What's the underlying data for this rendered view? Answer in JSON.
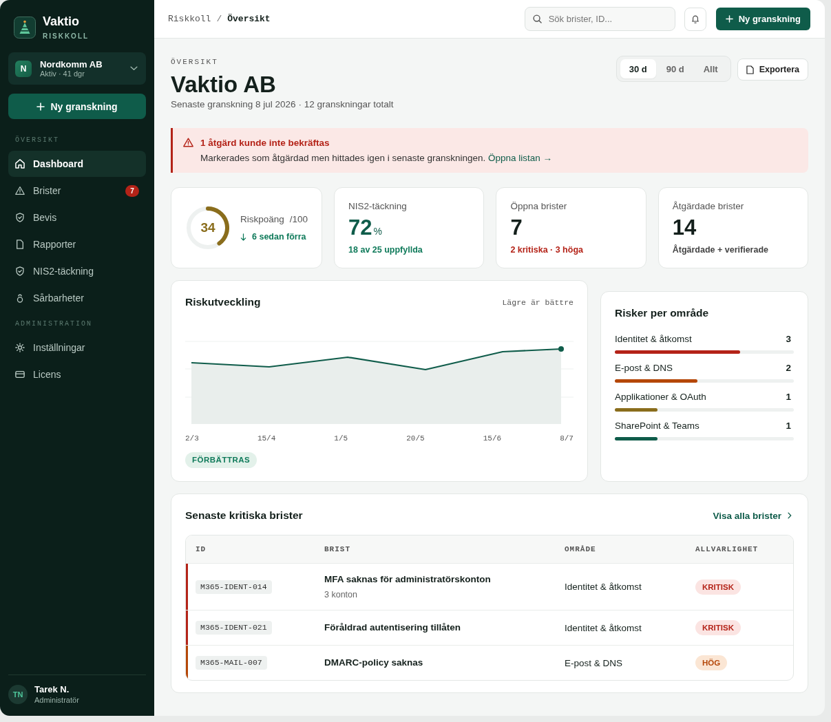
{
  "sidebar": {
    "brand": {
      "name": "Vaktio",
      "tagline": "RISKKOLL"
    },
    "org": {
      "avatar": "N",
      "name": "Nordkomm AB",
      "status": "Aktiv · 41 dgr"
    },
    "new_button": "Ny granskning",
    "sections": [
      {
        "title": "ÖVERSIKT",
        "items": [
          {
            "label": "Dashboard",
            "selected": true
          },
          {
            "label": "Brister",
            "selected": false,
            "badge": "7"
          },
          {
            "label": "Bevis",
            "selected": false
          },
          {
            "label": "Rapporter",
            "selected": false
          },
          {
            "label": "NIS2-täckning",
            "selected": false
          },
          {
            "label": "Sårbarheter",
            "selected": false
          }
        ]
      },
      {
        "title": "ADMINISTRATION",
        "items": [
          {
            "label": "Inställningar",
            "selected": false
          },
          {
            "label": "Licens",
            "selected": false
          }
        ]
      }
    ],
    "user": {
      "avatar": "TN",
      "name": "Tarek N.",
      "role": "Administratör"
    }
  },
  "header": {
    "breadcrumb": [
      {
        "label": "Riskkoll",
        "current": false
      },
      {
        "label": "Översikt",
        "current": true
      }
    ],
    "separator": "/",
    "search": {
      "placeholder": "Sök brister, ID..."
    },
    "new_button": "Ny granskning"
  },
  "page": {
    "eyebrow": "ÖVERSIKT",
    "title": "Vaktio AB",
    "subtitle": "Senaste granskning 8 jul 2026 · 12 granskningar totalt",
    "ranges": [
      {
        "label": "30 d",
        "selected": true
      },
      {
        "label": "90 d",
        "selected": false
      },
      {
        "label": "Allt",
        "selected": false
      }
    ],
    "export_button": "Exportera"
  },
  "alert": {
    "title": "1 åtgärd kunde inte bekräftas",
    "text": "Markerades som åtgärdad men hittades igen i senaste granskningen.",
    "link": "Öppna listan →"
  },
  "score": {
    "value": "34",
    "level": 0.4,
    "label": "Riskpoäng",
    "max": "/100",
    "trend": "6 sedan förra"
  },
  "stats": [
    {
      "label": "NIS2-täckning",
      "value": "72",
      "unit": "%",
      "note": "18 av 25 uppfyllda",
      "kind": "positive"
    },
    {
      "label": "Öppna brister",
      "value": "7",
      "note": "2 kritiska · 3 höga",
      "kind": "critical"
    },
    {
      "label": "Åtgärdade brister",
      "value": "14",
      "note": "Åtgärdade + verifierade",
      "kind": "neutral"
    }
  ],
  "trend_chart": {
    "title": "Riskutveckling",
    "note": "Lägre är bättre",
    "x_labels": [
      "2/3",
      "15/4",
      "1/5",
      "20/5",
      "15/6",
      "8/7"
    ],
    "badge": "FÖRBÄTTRAS"
  },
  "areas": {
    "title": "Risker per område",
    "items": [
      {
        "name": "Identitet & åtkomst",
        "count": "3",
        "level": 0.7,
        "color": "#b42318"
      },
      {
        "name": "E-post & DNS",
        "count": "2",
        "level": 0.46,
        "color": "#b54708"
      },
      {
        "name": "Applikationer & OAuth",
        "count": "1",
        "level": 0.24,
        "color": "#8a6d1c"
      },
      {
        "name": "SharePoint & Teams",
        "count": "1",
        "level": 0.24,
        "color": "#0f5c4a"
      }
    ]
  },
  "findings": {
    "title": "Senaste kritiska brister",
    "link": "Visa alla brister",
    "columns": [
      "ID",
      "BRIST",
      "OMRÅDE",
      "ALLVARLIGHET"
    ],
    "rows": [
      {
        "id": "M365-IDENT-014",
        "title": "MFA saknas för administratörskonton",
        "detail": "3 konton",
        "area": "Identitet & åtkomst",
        "kind": "critical",
        "severity": "KRITISK"
      },
      {
        "id": "M365-IDENT-021",
        "title": "Föråldrad autentisering tillåten",
        "area": "Identitet & åtkomst",
        "kind": "critical",
        "severity": "KRITISK"
      },
      {
        "id": "M365-MAIL-007",
        "title": "DMARC-policy saknas",
        "area": "E-post & DNS",
        "kind": "high",
        "severity": "HÖG"
      }
    ]
  }
}
